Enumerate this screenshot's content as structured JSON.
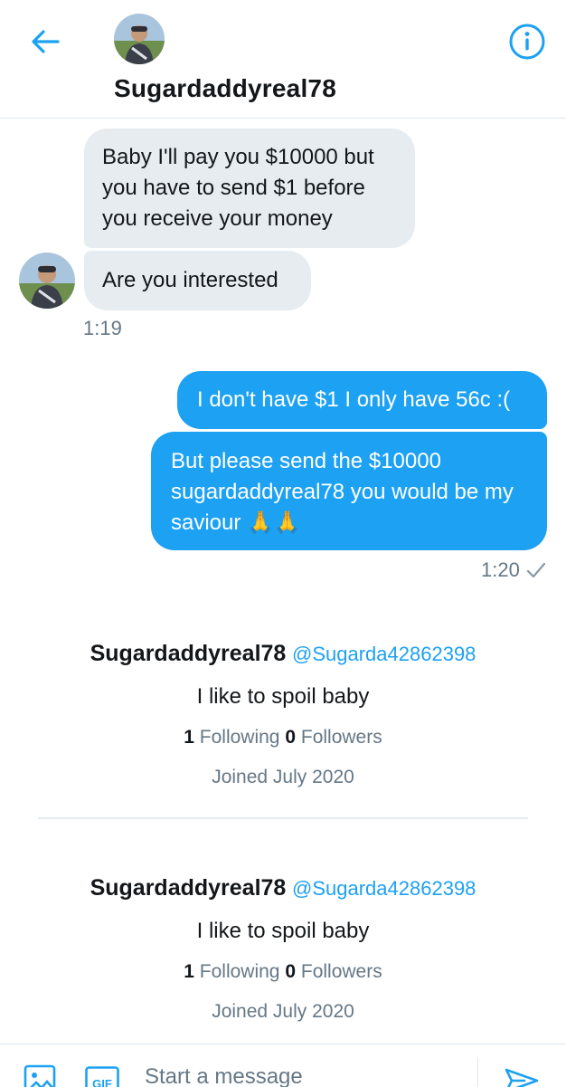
{
  "header": {
    "name": "Sugardaddyreal78",
    "back_icon": "arrow-left-icon",
    "info_icon": "info-icon"
  },
  "conversation": {
    "received": [
      {
        "text": "Baby I'll pay you $10000 but you have to send $1 before you receive your money"
      },
      {
        "text": "Are you interested"
      }
    ],
    "received_time": "1:19",
    "sent": [
      {
        "text": "I don't have $1 I only have 56c :("
      },
      {
        "text": "But please send the $10000 sugardaddyreal78 you would be my saviour 🙏🙏"
      }
    ],
    "sent_time": "1:20",
    "read_icon": "checkmark-icon"
  },
  "profile_cards": [
    {
      "name": "Sugardaddyreal78",
      "handle": "@Sugarda42862398",
      "bio": "I like to spoil baby",
      "following_count": "1",
      "following_label": "Following",
      "followers_count": "0",
      "followers_label": "Followers",
      "joined": "Joined July 2020"
    },
    {
      "name": "Sugardaddyreal78",
      "handle": "@Sugarda42862398",
      "bio": "I like to spoil baby",
      "following_count": "1",
      "following_label": "Following",
      "followers_count": "0",
      "followers_label": "Followers",
      "joined": "Joined July 2020"
    }
  ],
  "composer": {
    "placeholder": "Start a message",
    "gif_label": "GIF"
  },
  "colors": {
    "accent": "#1da1f2",
    "received_bubble": "#e6ecf0",
    "secondary_text": "#657786"
  }
}
